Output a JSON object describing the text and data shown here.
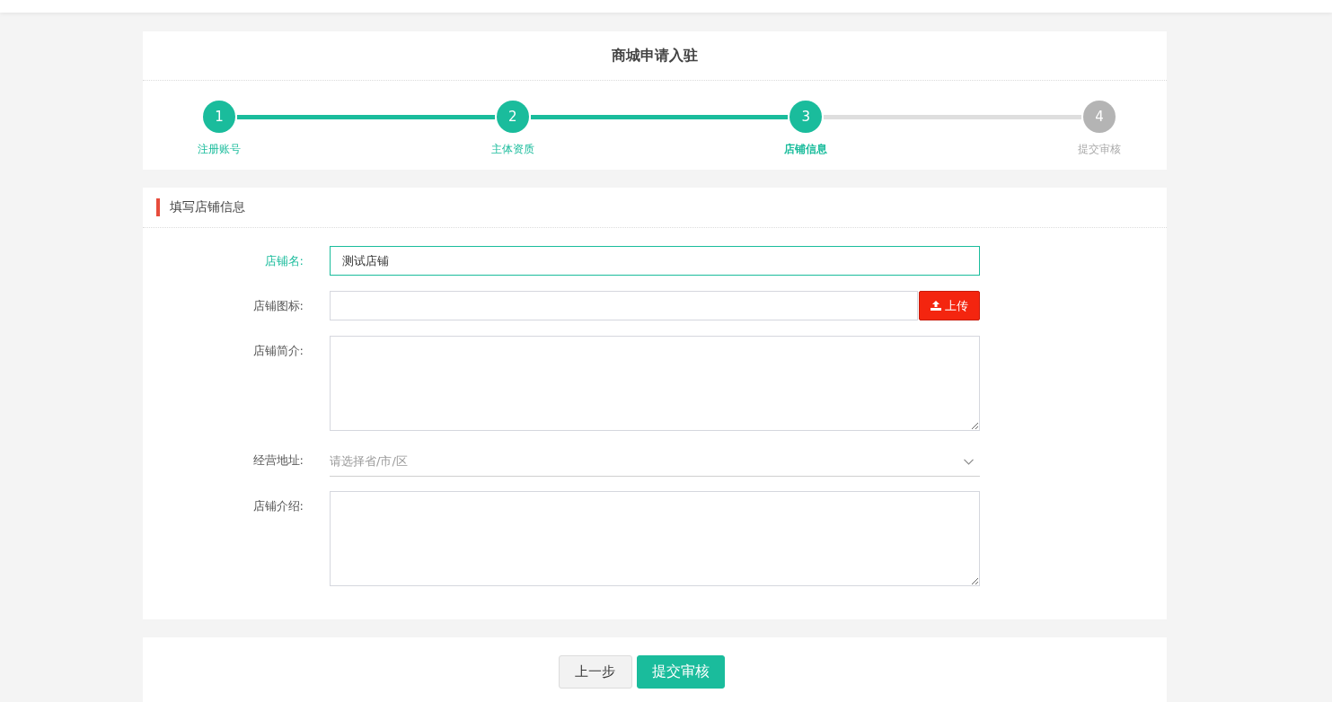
{
  "page_title": "商城申请入驻",
  "steps": [
    {
      "number": "1",
      "label": "注册账号",
      "selected": false
    },
    {
      "number": "2",
      "label": "主体资质",
      "selected": false
    },
    {
      "number": "3",
      "label": "店铺信息",
      "selected": true
    },
    {
      "number": "4",
      "label": "提交审核",
      "selected": false
    }
  ],
  "section": {
    "title": "填写店铺信息",
    "fields": [
      {
        "kind": "text",
        "label": "店铺名:",
        "value": "测试店铺",
        "focused": true
      },
      {
        "kind": "upload",
        "label": "店铺图标:",
        "button": "上传",
        "focused": false
      },
      {
        "kind": "textarea",
        "label": "店铺简介:",
        "focused": false
      },
      {
        "kind": "select",
        "label": "经营地址:",
        "placeholder": "请选择省/市/区",
        "focused": false
      },
      {
        "kind": "textarea",
        "label": "店铺介绍:",
        "focused": false
      }
    ]
  },
  "actions": [
    {
      "label": "上一步",
      "kind": "secondary"
    },
    {
      "label": "提交审核",
      "kind": "primary"
    }
  ]
}
